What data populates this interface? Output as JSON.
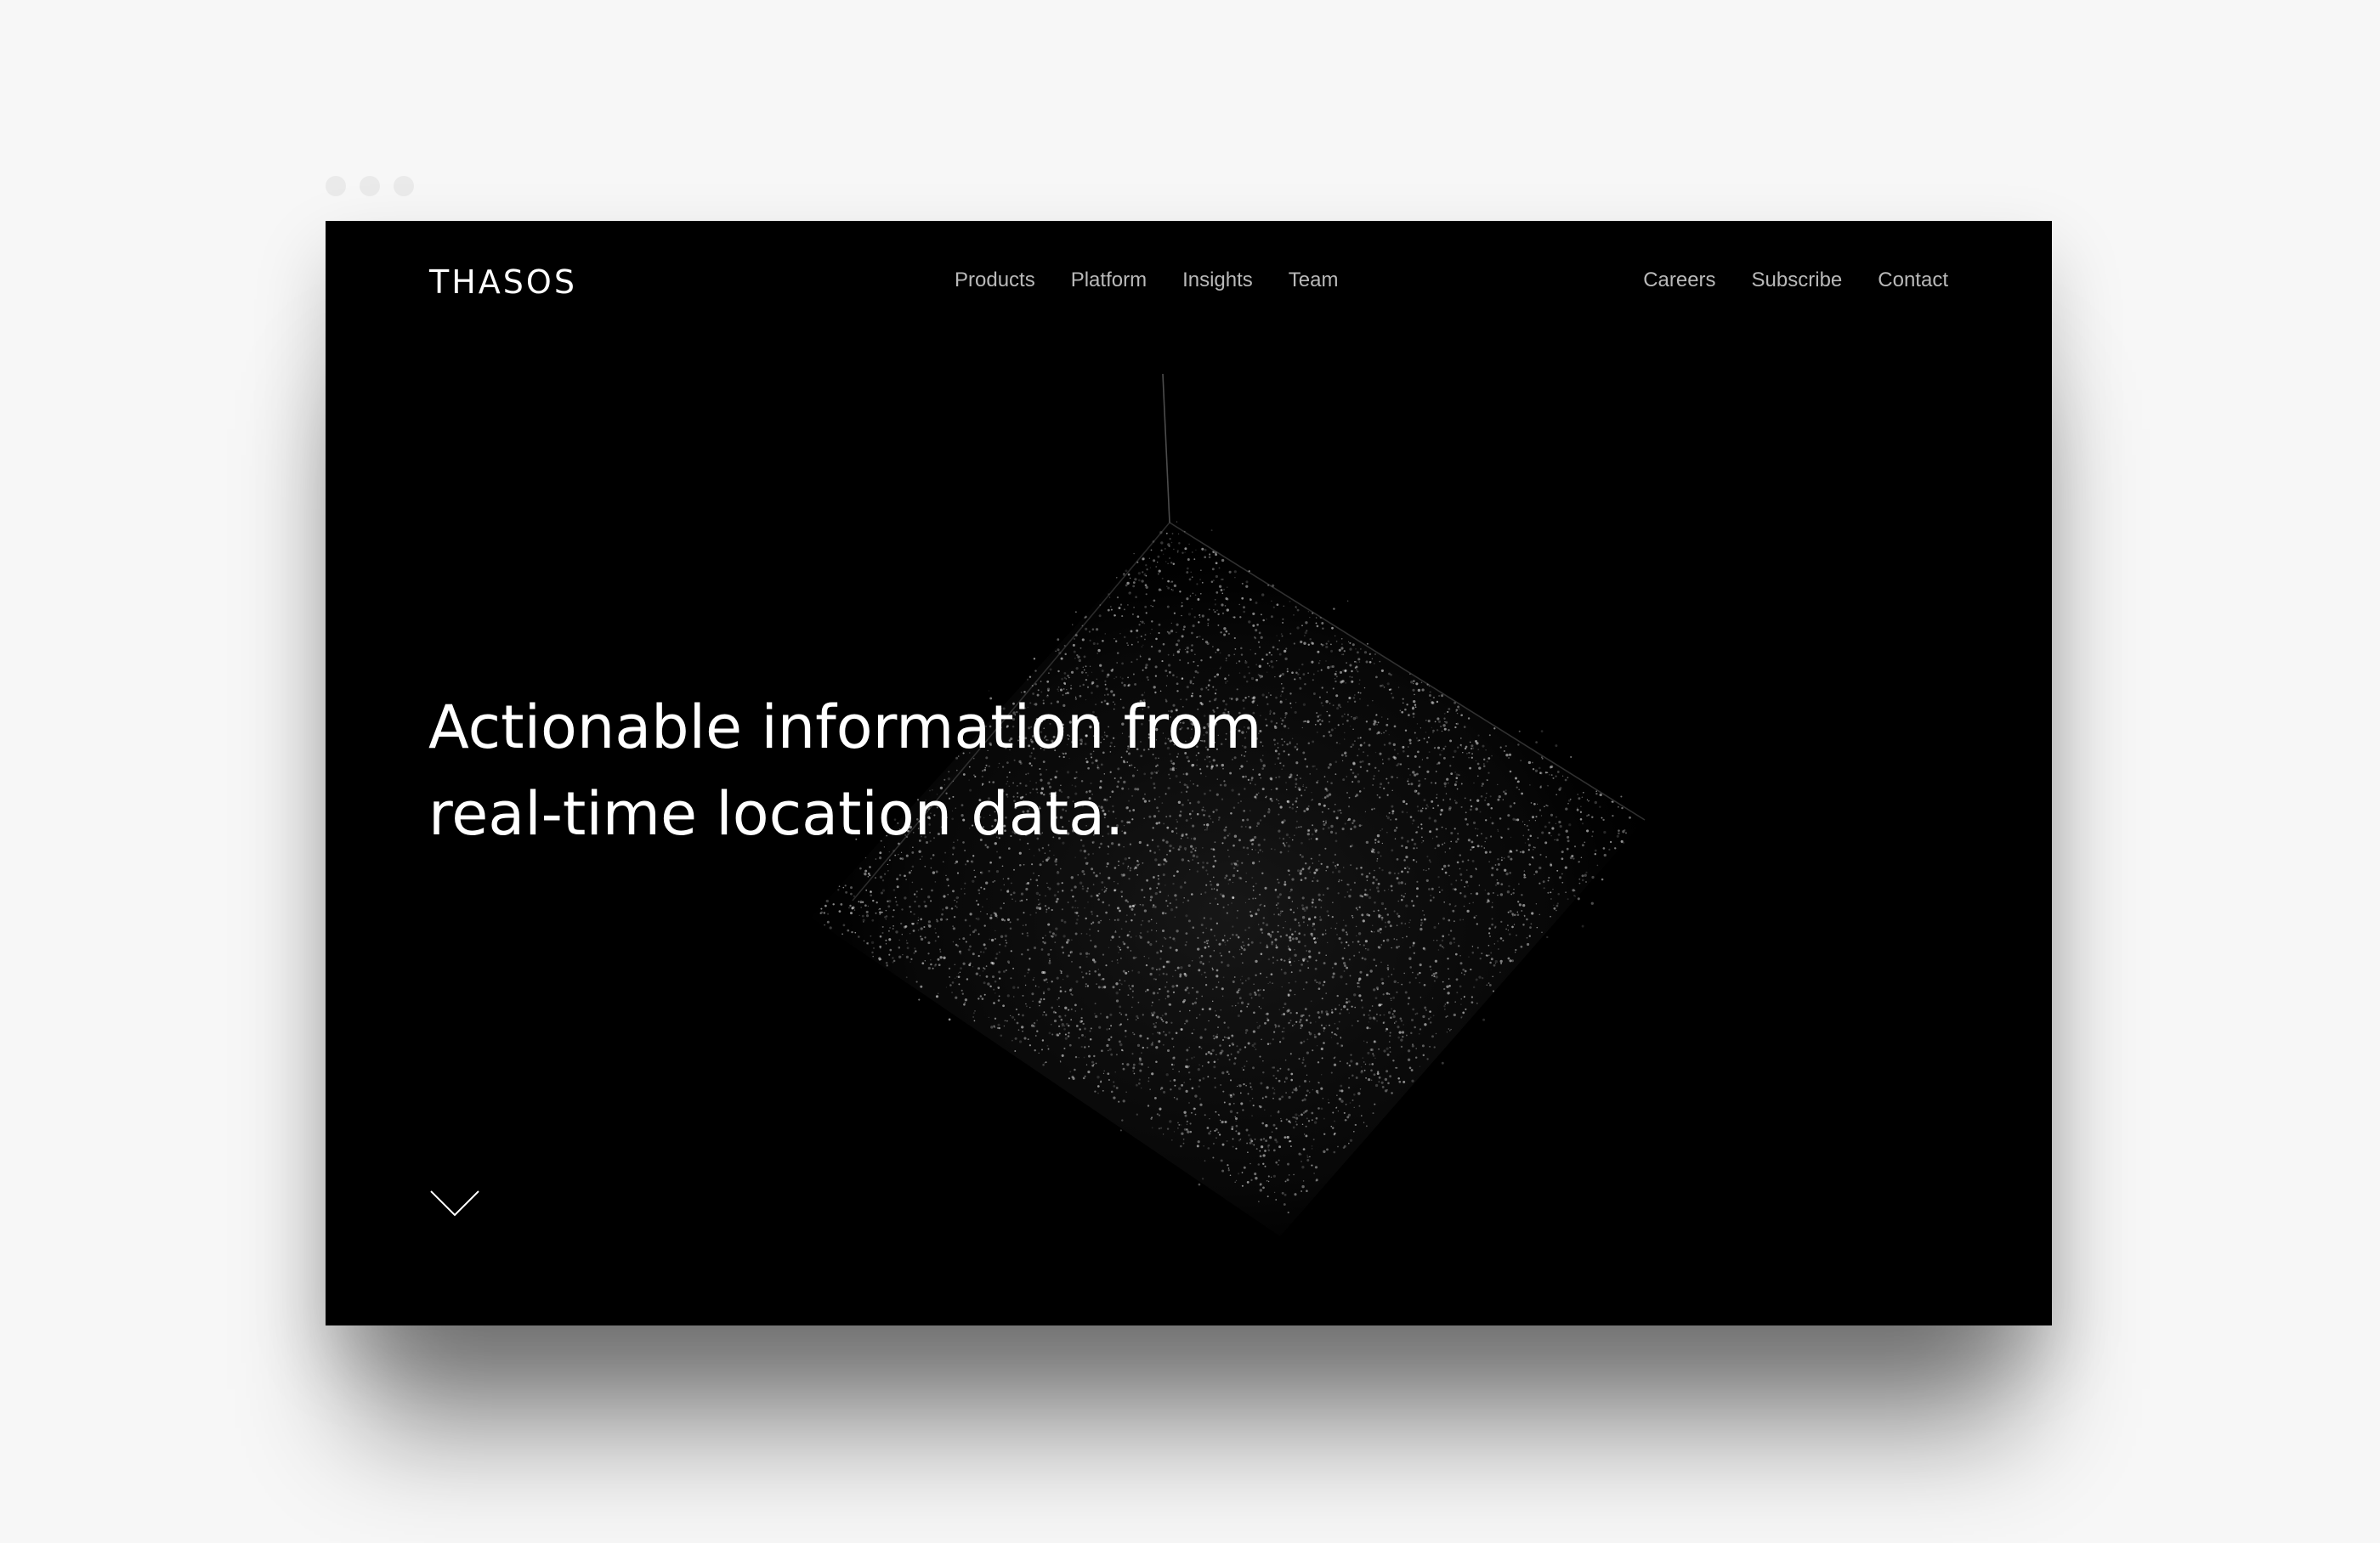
{
  "brand": {
    "logo_text": "THASOS"
  },
  "nav": {
    "main": [
      {
        "label": "Products"
      },
      {
        "label": "Platform"
      },
      {
        "label": "Insights"
      },
      {
        "label": "Team"
      }
    ],
    "secondary": [
      {
        "label": "Careers"
      },
      {
        "label": "Subscribe"
      },
      {
        "label": "Contact"
      }
    ]
  },
  "hero": {
    "title_line_1": "Actionable information from",
    "title_line_2": "real-time location data."
  },
  "icons": {
    "scroll": "chevron-down-icon",
    "window_controls": [
      "window-dot-icon",
      "window-dot-icon",
      "window-dot-icon"
    ]
  },
  "colors": {
    "page_background": "#f7f7f7",
    "window_background": "#000000",
    "nav_text": "#b9b9b9",
    "hero_text": "#ffffff",
    "particles": "#ffffff"
  }
}
